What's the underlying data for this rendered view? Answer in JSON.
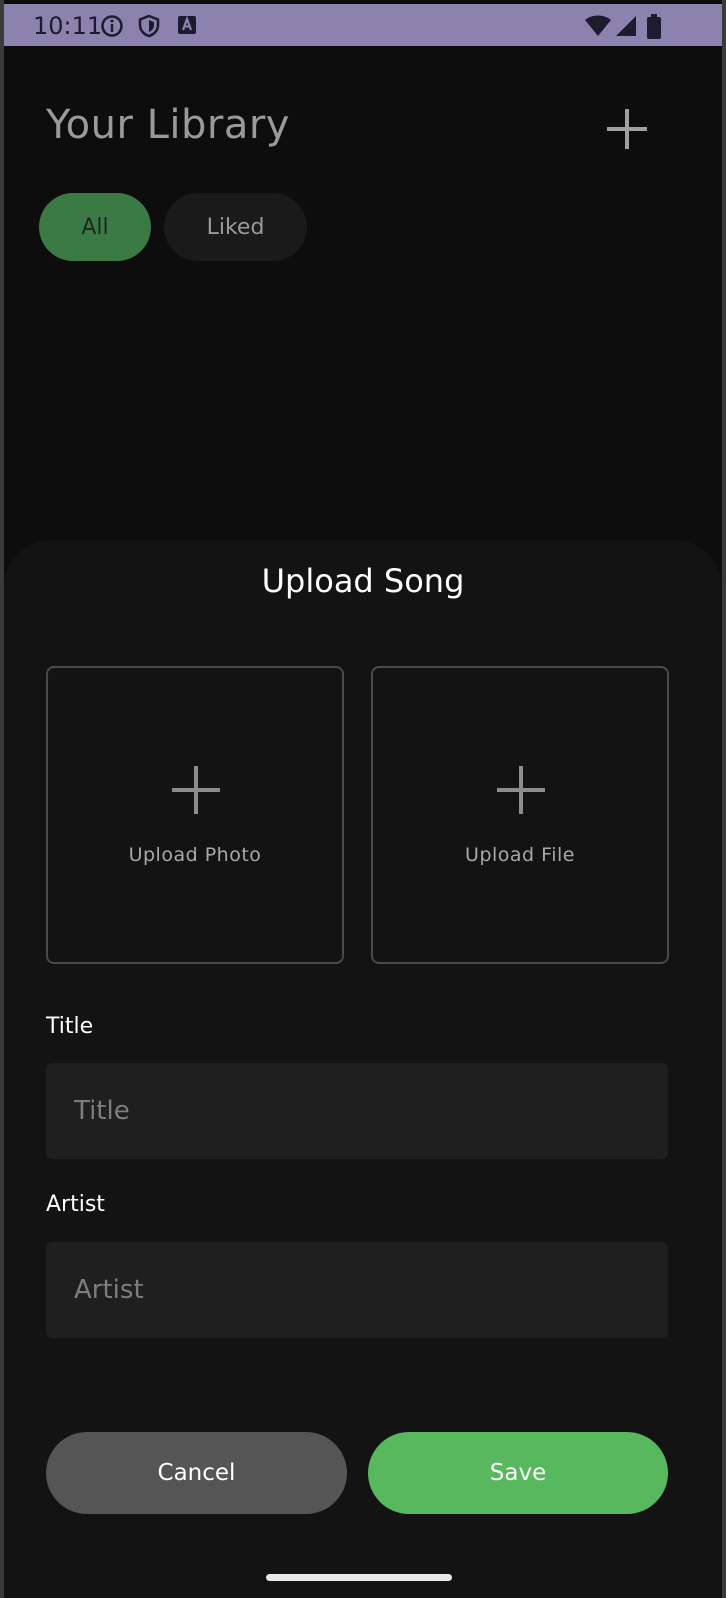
{
  "status_bar": {
    "time": "10:11",
    "icons": [
      "info-icon",
      "shield-icon",
      "keyboard-a-icon",
      "wifi-icon",
      "signal-icon",
      "battery-icon"
    ]
  },
  "library": {
    "title": "Your Library",
    "add_icon": "plus-icon",
    "chips": [
      {
        "label": "All",
        "selected": true
      },
      {
        "label": "Liked",
        "selected": false
      }
    ]
  },
  "upload_sheet": {
    "title": "Upload Song",
    "upload_photo_label": "Upload Photo",
    "upload_file_label": "Upload File",
    "title_field": {
      "label": "Title",
      "placeholder": "Title",
      "value": ""
    },
    "artist_field": {
      "label": "Artist",
      "placeholder": "Artist",
      "value": ""
    },
    "cancel_label": "Cancel",
    "save_label": "Save"
  },
  "colors": {
    "status_bar": "#8b83ad",
    "accent": "#58b85e",
    "selected_chip": "#3c7a45",
    "cancel_button": "#555555",
    "sheet_background": "#131313"
  }
}
